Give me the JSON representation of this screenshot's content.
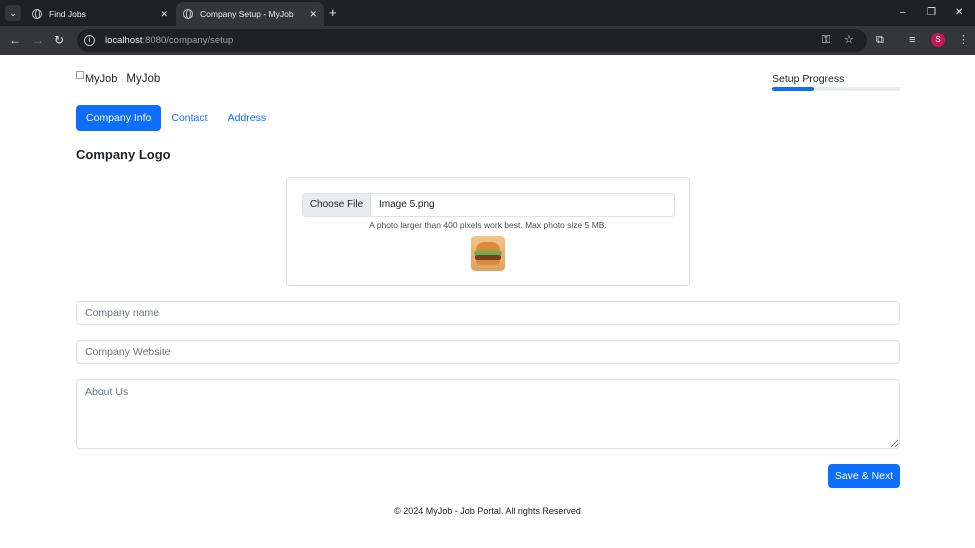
{
  "browser": {
    "tabs": [
      {
        "title": "Find Jobs",
        "active": false
      },
      {
        "title": "Company Setup - MyJob",
        "active": true
      }
    ],
    "new_tab": "+",
    "close_glyph": "✕",
    "search_tabs_glyph": "⌄",
    "url_host": "localhost",
    "url_path": ":8080/company/setup",
    "profile_initial": "S",
    "icons": [
      "back-icon",
      "forward-icon",
      "reload-icon",
      "site-info-icon",
      "password-key-icon",
      "bookmark-star-icon",
      "extensions-icon",
      "reading-list-icon",
      "menu-icon"
    ]
  },
  "header": {
    "logo_alt": "MyJob",
    "brand_name": "MyJob",
    "progress_label": "Setup Progress",
    "progress_fraction": 0.33
  },
  "nav": {
    "tabs": [
      {
        "label": "Company Info",
        "active": true
      },
      {
        "label": "Contact",
        "active": false
      },
      {
        "label": "Address",
        "active": false
      }
    ]
  },
  "logo_section": {
    "title": "Company Logo",
    "choose_file_label": "Choose File",
    "file_name": "Image 5.png",
    "help_text": "A photo larger than 400 pixels work best. Max photo size 5 MB."
  },
  "form": {
    "company_name_placeholder": "Company name",
    "company_website_placeholder": "Company Website",
    "about_placeholder": "About Us",
    "save_label": "Save & Next"
  },
  "footer": {
    "text": "© 2024 MyJob - Job Portal. All rights Reserved"
  },
  "colors": {
    "primary": "#0d6efd",
    "chrome_dark": "#202124",
    "chrome_tab": "#35363a"
  }
}
